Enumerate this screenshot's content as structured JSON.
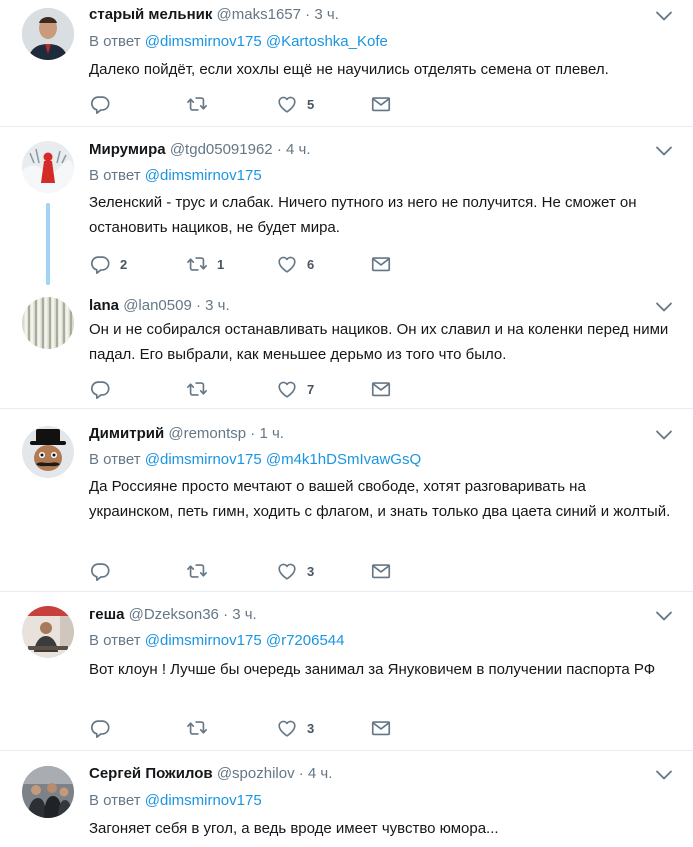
{
  "reply_prefix": "В ответ",
  "tweets": [
    {
      "name": "старый мельник",
      "handle": "@maks1657",
      "dot": "·",
      "time": "3 ч.",
      "mentions": [
        "@dimsmirnov175",
        "@Kartoshka_Kofe"
      ],
      "text": "Далеко пойдёт, если хохлы ещё не научились отделять семена от плевел.",
      "replies": "",
      "retweets": "",
      "likes": "5"
    },
    {
      "name": "Мирумира",
      "handle": "@tgd05091962",
      "dot": "·",
      "time": "4 ч.",
      "mentions": [
        "@dimsmirnov175"
      ],
      "text": "Зеленский - трус и слабак. Ничего путного из него не получится. Не сможет он остановить нациков, не будет мира.",
      "replies": "2",
      "retweets": "1",
      "likes": "6"
    },
    {
      "name": "lana",
      "handle": "@lan0509",
      "dot": "·",
      "time": "3 ч.",
      "mentions": [],
      "text": "Он и не собирался останавливать нациков. Он их славил и на коленки перед ними падал. Его выбрали, как меньшее дерьмо из того что было.",
      "replies": "",
      "retweets": "",
      "likes": "7"
    },
    {
      "name": "Димитрий",
      "handle": "@remontsp",
      "dot": "·",
      "time": "1 ч.",
      "mentions": [
        "@dimsmirnov175",
        "@m4k1hDSmIvawGsQ"
      ],
      "text": "Да Россияне просто мечтают о вашей свободе, хотят разговаривать на украинском, петь гимн, ходить с флагом, и знать только два цаета синий и жолтый.",
      "replies": "",
      "retweets": "",
      "likes": "3"
    },
    {
      "name": "геша",
      "handle": "@Dzekson36",
      "dot": "·",
      "time": "3 ч.",
      "mentions": [
        "@dimsmirnov175",
        "@r7206544"
      ],
      "text": "Вот клоун ! Лучше бы очередь занимал за Януковичем в получении паспорта РФ",
      "replies": "",
      "retweets": "",
      "likes": "3"
    },
    {
      "name": "Сергей Пожилов",
      "handle": "@spozhilov",
      "dot": "·",
      "time": "4 ч.",
      "mentions": [
        "@dimsmirnov175"
      ],
      "text": "Загоняет себя в угол, а ведь вроде имеет чувство юмора...",
      "replies": "",
      "retweets": "",
      "likes": ""
    }
  ]
}
